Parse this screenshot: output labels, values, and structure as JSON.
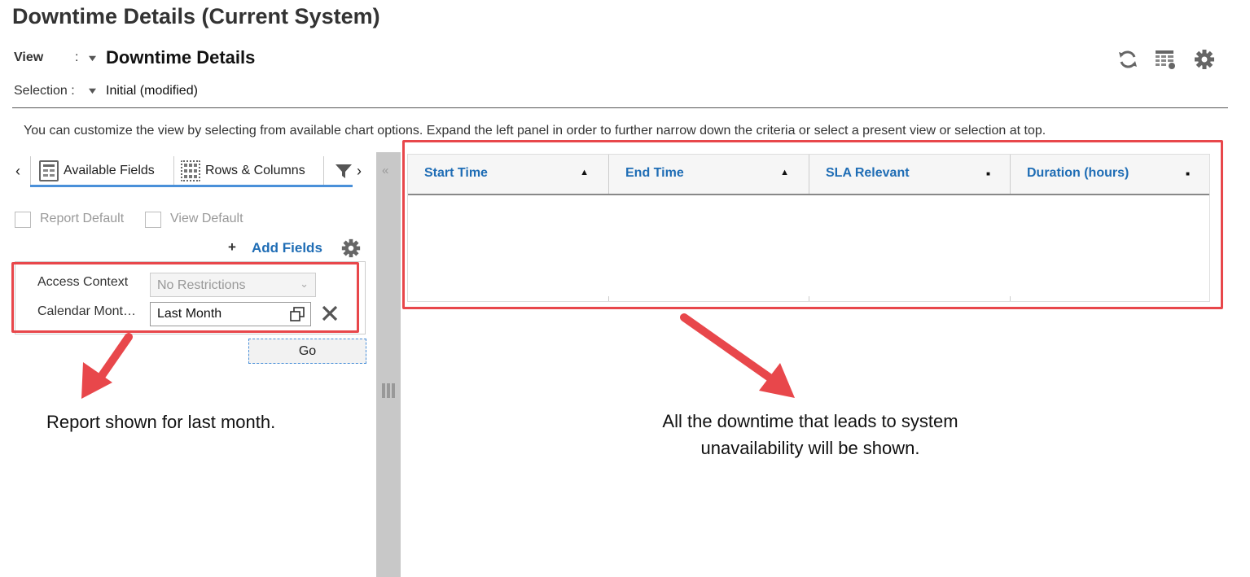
{
  "page": {
    "title": "Downtime Details (Current System)"
  },
  "header": {
    "view_label": "View",
    "view_colon": ":",
    "view_value": "Downtime Details",
    "selection_label": "Selection :",
    "selection_value": "Initial (modified)"
  },
  "info_text": "You can customize the view by selecting from available chart options. Expand the left panel in order to further narrow down the criteria or select a present view or selection at top.",
  "left_panel": {
    "tabs": [
      {
        "label": "Available Fields"
      },
      {
        "label": "Rows & Columns"
      }
    ],
    "report_default_label": "Report Default",
    "view_default_label": "View Default",
    "add_fields_plus": "+",
    "add_fields_label": "Add Fields",
    "filters": [
      {
        "label": "Access Context",
        "value": "No Restrictions"
      },
      {
        "label": "Calendar Mont…",
        "value": "Last Month"
      }
    ],
    "go_label": "Go"
  },
  "grid": {
    "columns": [
      {
        "label": "Start Time",
        "sort": "▲"
      },
      {
        "label": "End Time",
        "sort": "▲"
      },
      {
        "label": "SLA Relevant",
        "sort": "■"
      },
      {
        "label": "Duration (hours)",
        "sort": "■"
      }
    ]
  },
  "annotations": {
    "left": "Report shown for last month.",
    "right_line1": "All the downtime that leads to system",
    "right_line2": "unavailability will be shown."
  },
  "colors": {
    "accent": "#1f6db5",
    "annotation_red": "#e8474b",
    "tab_underline": "#4a90d9"
  },
  "icons": [
    "refresh-icon",
    "table-settings-icon",
    "gear-icon",
    "filter-icon",
    "calendar-picker-icon",
    "clear-icon",
    "collapse-left-icon",
    "splitter-grip-icon"
  ]
}
